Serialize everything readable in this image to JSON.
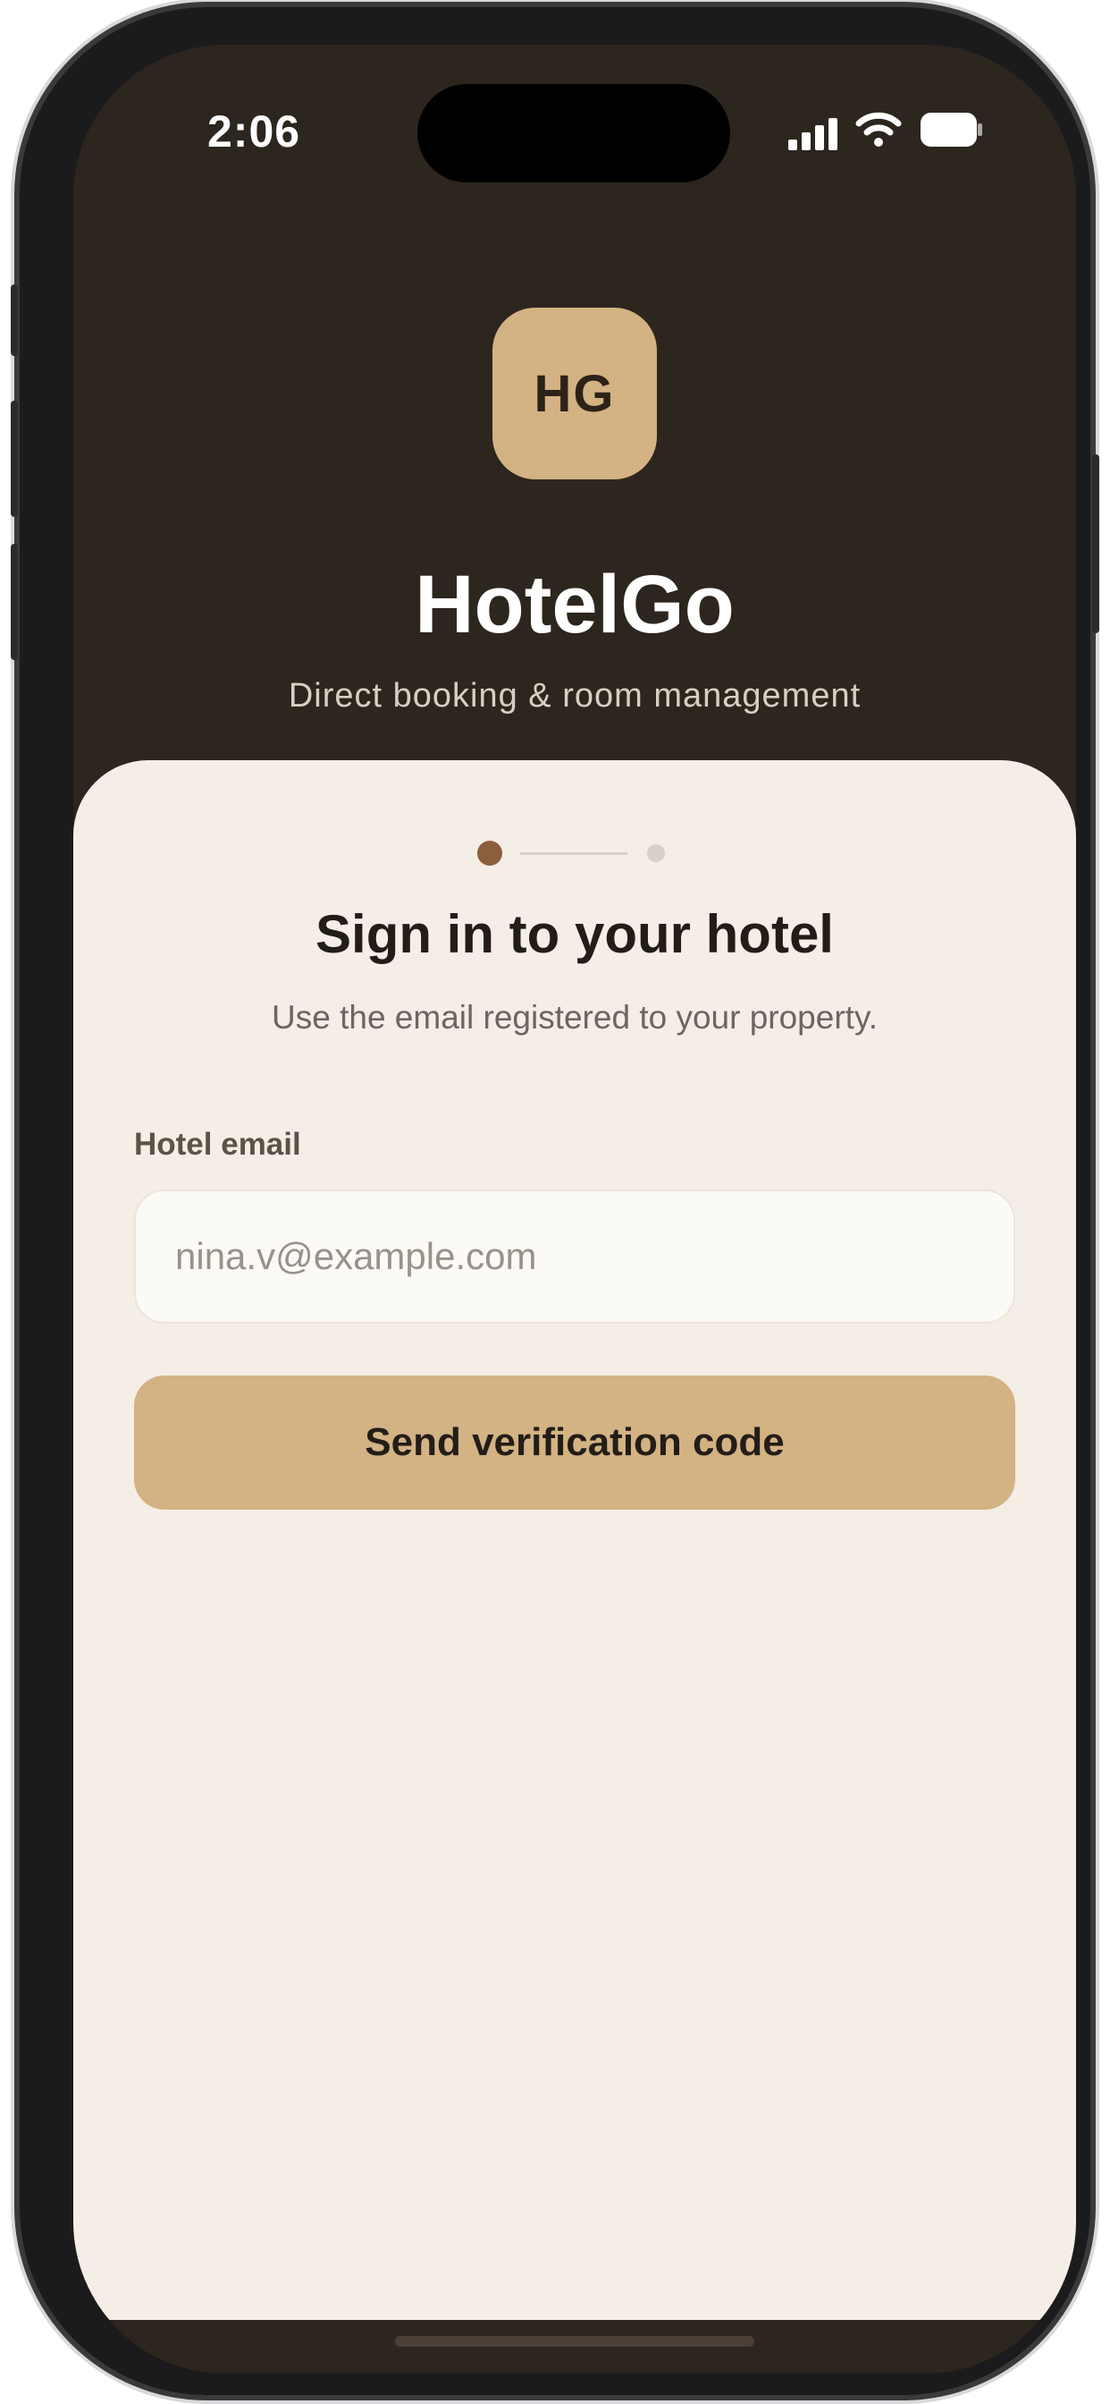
{
  "status_bar": {
    "time": "2:06",
    "signal_icon": "cellular-signal-icon",
    "wifi_icon": "wifi-icon",
    "battery_icon": "battery-icon"
  },
  "brand": {
    "logo_text": "HG",
    "app_name": "HotelGo",
    "tagline": "Direct booking & room management"
  },
  "progress": {
    "current_step": 1,
    "total_steps": 2
  },
  "sign_in": {
    "title": "Sign in to your hotel",
    "subtitle": "Use the email registered to your property.",
    "email_label": "Hotel email",
    "email_placeholder": "nina.v@example.com",
    "email_value": "",
    "submit_label": "Send verification code"
  },
  "colors": {
    "header_background": "#2d261e",
    "accent": "#d3b283",
    "card_background": "#f5eee6",
    "step_active": "#8b5e3c"
  }
}
